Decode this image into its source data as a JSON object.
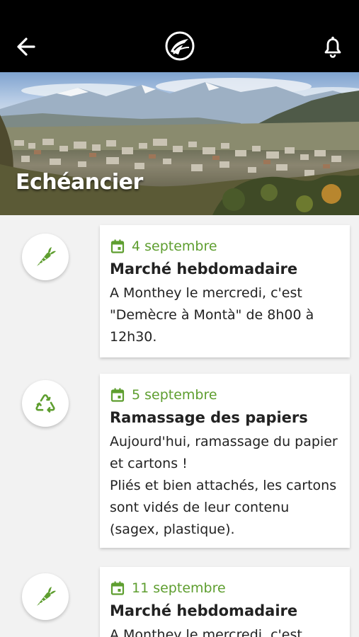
{
  "header": {
    "back_icon": "arrow-left-icon",
    "logo_icon": "monthey-logo-icon",
    "notifications_icon": "bell-icon"
  },
  "hero": {
    "title": "Echéancier"
  },
  "events": [
    {
      "icon": "carrot-icon",
      "date": "4 septembre",
      "title": "Marché hebdomadaire",
      "description": "A Monthey le mercredi, c'est \"Demècre à Montà\" de 8h00 à 12h30."
    },
    {
      "icon": "recycle-icon",
      "date": "5 septembre",
      "title": "Ramassage des papiers",
      "description": "Aujourd'hui, ramassage du papier et cartons !\nPliés et bien attachés, les cartons sont vidés de leur contenu (sagex, plastique)."
    },
    {
      "icon": "carrot-icon",
      "date": "11 septembre",
      "title": "Marché hebdomadaire",
      "description": "A Monthey le mercredi, c'est"
    }
  ],
  "colors": {
    "accent_green": "#5e9e2f",
    "topbar": "#000000",
    "background": "#f2f2f2"
  }
}
